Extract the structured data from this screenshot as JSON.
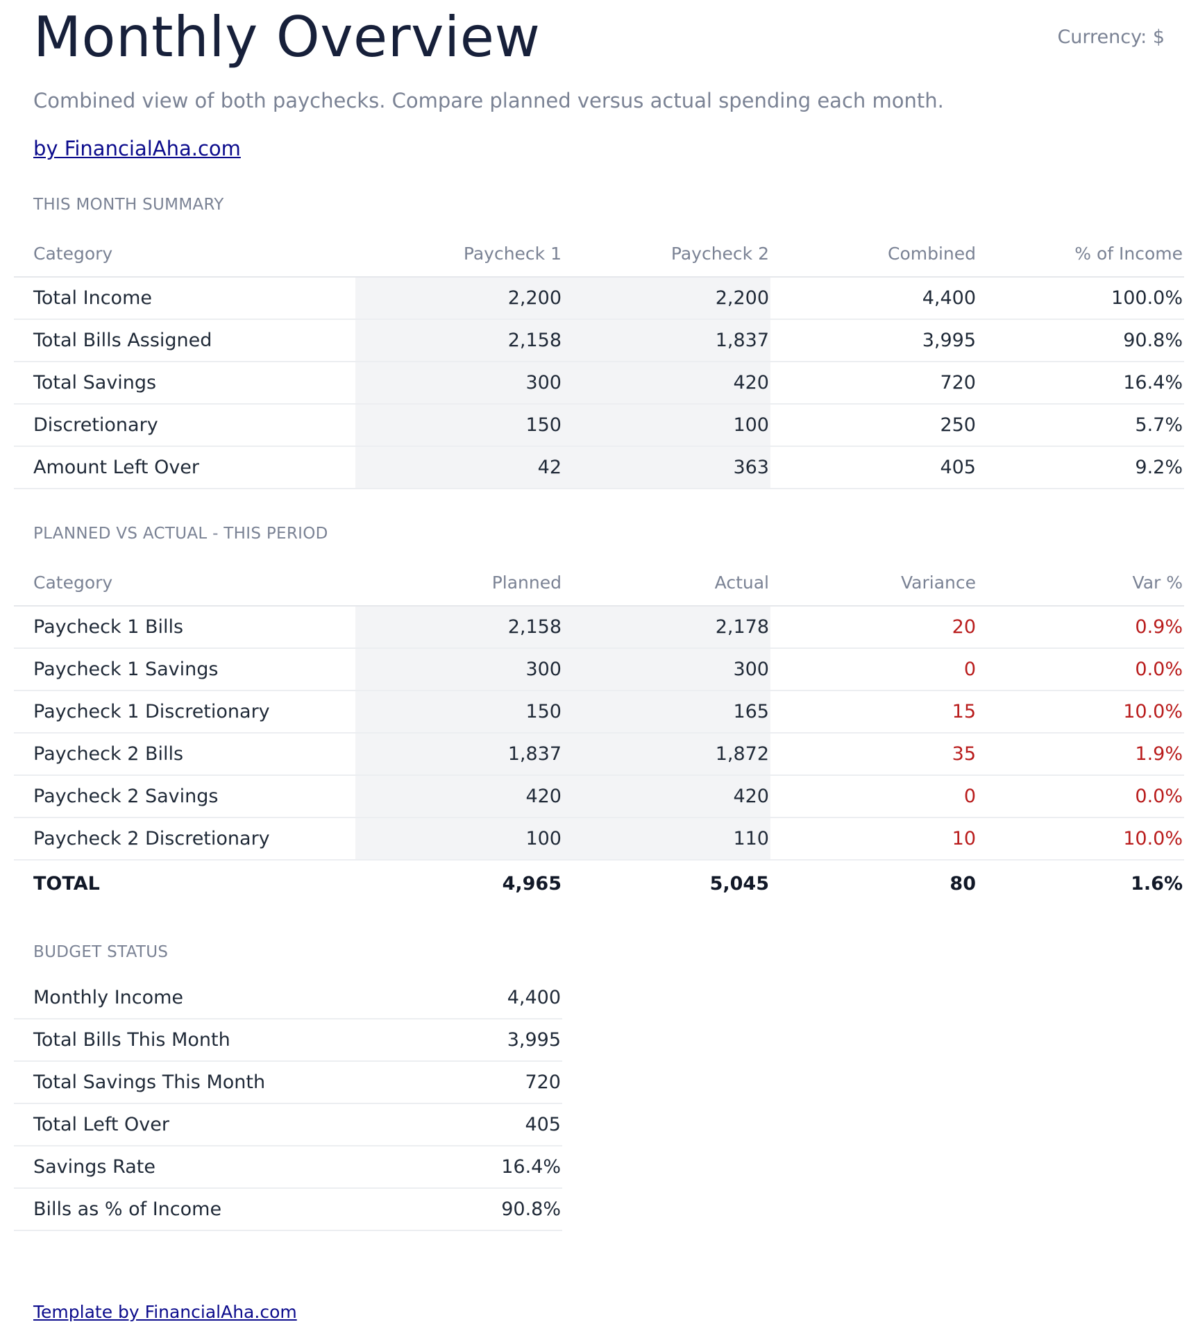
{
  "header": {
    "title": "Monthly Overview",
    "currency": "Currency: $",
    "subtitle": "Combined view of both paychecks. Compare planned versus actual spending each month.",
    "link": "by FinancialAha.com"
  },
  "summary": {
    "section_title": "THIS MONTH SUMMARY",
    "columns": [
      "Category",
      "Paycheck 1",
      "Paycheck 2",
      "Combined",
      "% of Income"
    ],
    "rows": [
      [
        "Total Income",
        "2,200",
        "2,200",
        "4,400",
        "100.0%"
      ],
      [
        "Total Bills Assigned",
        "2,158",
        "1,837",
        "3,995",
        "90.8%"
      ],
      [
        "Total Savings",
        "300",
        "420",
        "720",
        "16.4%"
      ],
      [
        "Discretionary",
        "150",
        "100",
        "250",
        "5.7%"
      ],
      [
        "Amount Left Over",
        "42",
        "363",
        "405",
        "9.2%"
      ]
    ]
  },
  "planned_actual": {
    "section_title": "PLANNED VS ACTUAL - THIS PERIOD",
    "columns": [
      "Category",
      "Planned",
      "Actual",
      "Variance",
      "Var %"
    ],
    "rows": [
      [
        "Paycheck 1 Bills",
        "2,158",
        "2,178",
        "20",
        "0.9%"
      ],
      [
        "Paycheck 1 Savings",
        "300",
        "300",
        "0",
        "0.0%"
      ],
      [
        "Paycheck 1 Discretionary",
        "150",
        "165",
        "15",
        "10.0%"
      ],
      [
        "Paycheck 2 Bills",
        "1,837",
        "1,872",
        "35",
        "1.9%"
      ],
      [
        "Paycheck 2 Savings",
        "420",
        "420",
        "0",
        "0.0%"
      ],
      [
        "Paycheck 2 Discretionary",
        "100",
        "110",
        "10",
        "10.0%"
      ]
    ],
    "total": [
      "TOTAL",
      "4,965",
      "5,045",
      "80",
      "1.6%"
    ]
  },
  "budget_status": {
    "section_title": "BUDGET STATUS",
    "rows": [
      [
        "Monthly Income",
        "4,400"
      ],
      [
        "Total Bills This Month",
        "3,995"
      ],
      [
        "Total Savings This Month",
        "720"
      ],
      [
        "Total Left Over",
        "405"
      ],
      [
        "Savings Rate",
        "16.4%"
      ],
      [
        "Bills as % of Income",
        "90.8%"
      ]
    ]
  },
  "footer": {
    "link": "Template by FinancialAha.com"
  },
  "colors": {
    "title": "#17203a",
    "muted": "#7a8294",
    "link": "#0b0b8c",
    "variance": "#b91c1c",
    "shaded_column": "#f3f4f6"
  }
}
